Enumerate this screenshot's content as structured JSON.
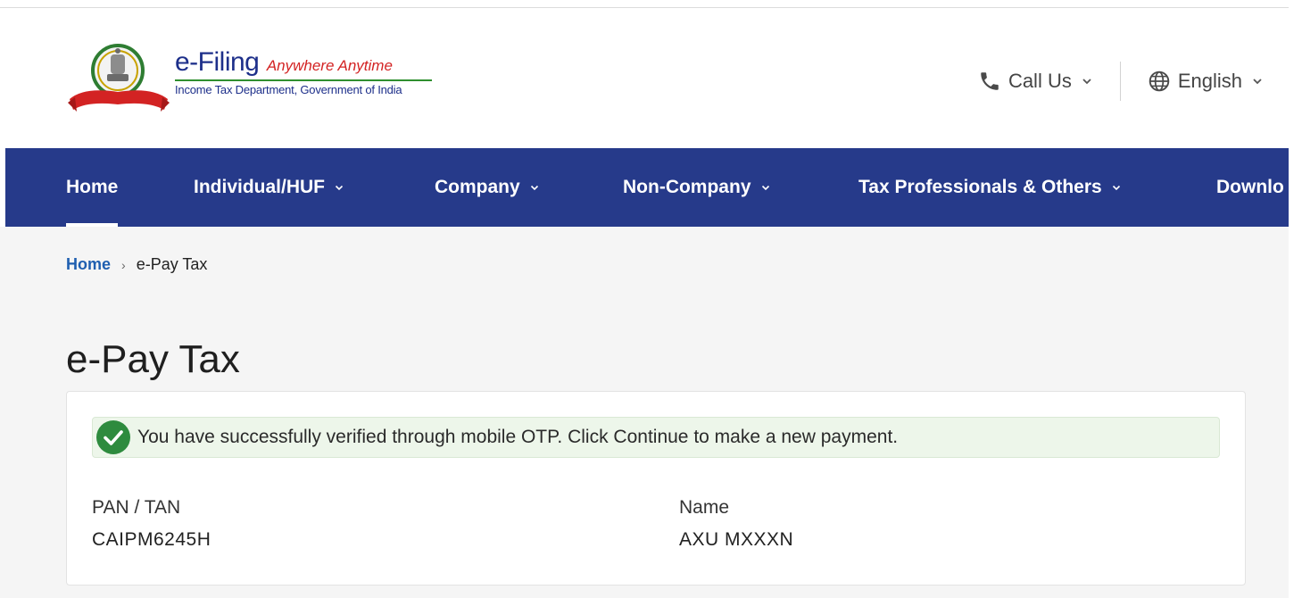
{
  "header": {
    "brand_main": "e-Filing",
    "brand_tagline": "Anywhere Anytime",
    "brand_subtitle": "Income Tax Department, Government of India",
    "call_us_label": "Call Us",
    "language_label": "English"
  },
  "nav": {
    "items": [
      {
        "label": "Home",
        "active": true,
        "has_dropdown": false
      },
      {
        "label": "Individual/HUF",
        "active": false,
        "has_dropdown": true
      },
      {
        "label": "Company",
        "active": false,
        "has_dropdown": true
      },
      {
        "label": "Non-Company",
        "active": false,
        "has_dropdown": true
      },
      {
        "label": "Tax Professionals & Others",
        "active": false,
        "has_dropdown": true
      },
      {
        "label": "Downlo",
        "active": false,
        "has_dropdown": false
      }
    ]
  },
  "breadcrumb": {
    "home": "Home",
    "current": "e-Pay Tax"
  },
  "page": {
    "title": "e-Pay Tax"
  },
  "alert": {
    "message": "You have successfully verified through mobile OTP. Click Continue to make a new payment."
  },
  "details": {
    "pan_label": "PAN / TAN",
    "pan_value": "CAIPM6245H",
    "name_label": "Name",
    "name_value": "AXU MXXXN"
  },
  "colors": {
    "nav_bg": "#263a8a",
    "link": "#1f5fb0",
    "success": "#2e8b3e",
    "alert_bg": "#edf6ea"
  }
}
